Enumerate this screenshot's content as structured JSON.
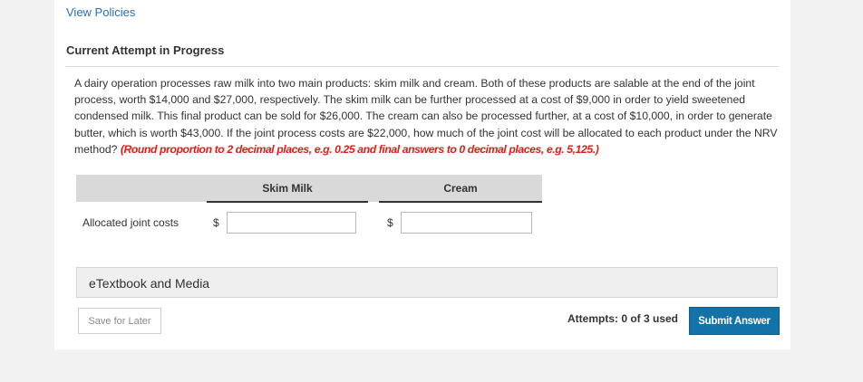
{
  "links": {
    "view_policies": "View Policies"
  },
  "attempt": {
    "title": "Current Attempt in Progress"
  },
  "question": {
    "text": "A dairy operation processes raw milk into two main products: skim milk and cream. Both of these products are salable at the end of the joint process, worth $14,000 and $27,000, respectively. The skim milk can be further processed at a cost of $9,000 in order to yield sweetened condensed milk. This final product can be sold for $26,000. The cream can also be processed further, at a cost of $10,000, in order to generate butter, which is worth $43,000. If the joint process costs are $22,000, how much of the joint cost will be allocated to each product under the NRV method?",
    "instruction": "(Round proportion to 2 decimal places, e.g. 0.25 and final answers to 0 decimal places, e.g. 5,125.)"
  },
  "table": {
    "columns": [
      "Skim Milk",
      "Cream"
    ],
    "rows": [
      {
        "label": "Allocated joint costs",
        "currency_symbol": "$",
        "values": [
          "",
          ""
        ]
      }
    ]
  },
  "resources": {
    "etextbook_label": "eTextbook and Media"
  },
  "footer": {
    "save_label": "Save for Later",
    "attempts_text": "Attempts: 0 of 3 used",
    "submit_label": "Submit Answer"
  },
  "colors": {
    "link": "#2a6ebb",
    "instruction": "#e41b17",
    "submit_button": "#1373a8",
    "header_band": "#d9d9d9"
  }
}
